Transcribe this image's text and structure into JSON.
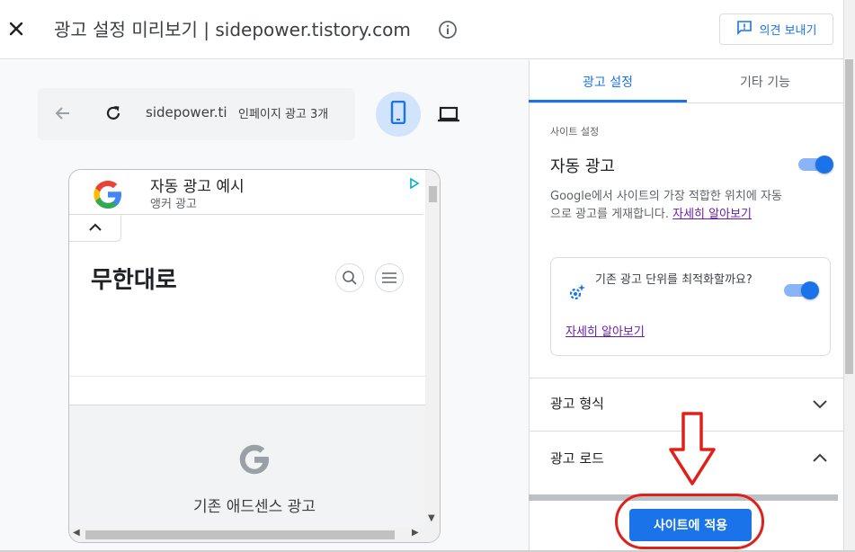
{
  "header": {
    "title": "광고 설정 미리보기 | sidepower.tistory.com",
    "feedback_label": "의견 보내기"
  },
  "preview": {
    "url": "sidepower.ti",
    "ad_count": "인페이지 광고 3개"
  },
  "phone": {
    "anchor_ad_title": "자동 광고 예시",
    "anchor_ad_sub": "앵커 광고",
    "blog_title": "무한대로",
    "inpage_ad_label": "기존 애드센스 광고"
  },
  "settings": {
    "tabs": [
      {
        "label": "광고 설정",
        "active": true
      },
      {
        "label": "기타 기능",
        "active": false
      }
    ],
    "section_heading": "사이트 설정",
    "auto_ads_label": "자동 광고",
    "auto_ads_enabled": true,
    "description": "Google에서 사이트의 가장 적합한 위치에 자동으로 광고를 게재합니다.",
    "learn_more_link": "자세히 알아보기",
    "optimize_question": "기존 광고 단위를 최적화할까요?",
    "optimize_enabled": true,
    "optimize_link": "자세히 알아보기",
    "ad_formats_label": "광고 형식",
    "ad_load_label": "광고 로드",
    "apply_button": "사이트에 적용"
  },
  "colors": {
    "accent": "#1a73e8",
    "annotation": "#e0201b",
    "link": "#681da8"
  },
  "icons": [
    "close-icon",
    "info-icon",
    "feedback-icon",
    "back-arrow-icon",
    "reload-icon",
    "mobile-icon",
    "desktop-icon",
    "google-logo-icon",
    "adchoices-icon",
    "chevron-up-icon",
    "search-icon",
    "menu-icon",
    "optimize-gear-icon",
    "chevron-down-icon",
    "red-arrow-annotation"
  ]
}
